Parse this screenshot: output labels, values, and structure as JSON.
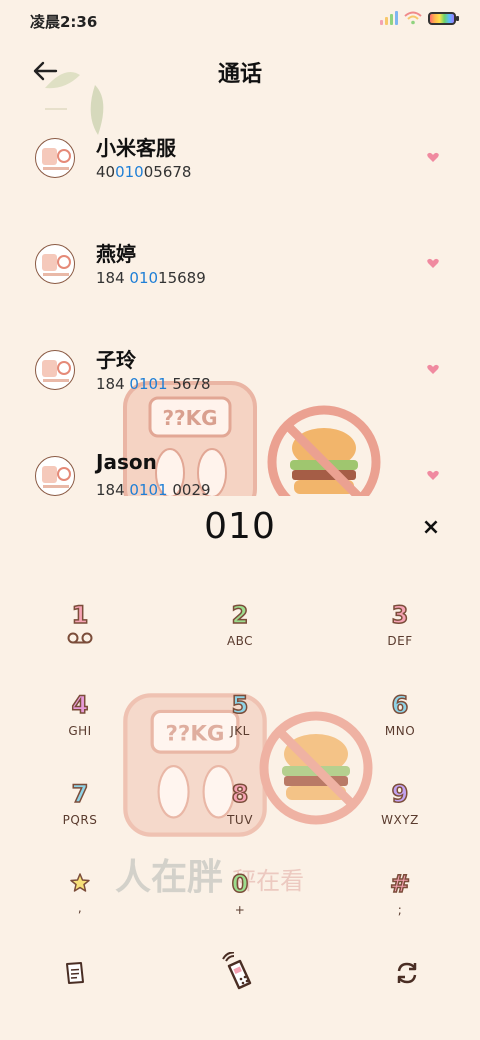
{
  "status_bar": {
    "time": "凌晨2:36"
  },
  "header": {
    "title": "通话",
    "back_icon": "arrow-left-icon"
  },
  "contacts": [
    {
      "name": "小米客服",
      "number_pre": "40",
      "number_hl": "010",
      "number_post": "05678"
    },
    {
      "name": "燕婷",
      "number_pre": "184 ",
      "number_hl": "010",
      "number_post": "15689"
    },
    {
      "name": "子玲",
      "number_pre": "184 ",
      "number_hl": "0101",
      "number_post": " 5678"
    },
    {
      "name": "Jason",
      "number_pre": "184 ",
      "number_hl": "0101",
      "number_post": " 0029"
    }
  ],
  "dialer": {
    "input": "010",
    "clear_label": "×",
    "keys": [
      {
        "digit": "1",
        "letters": "",
        "color": "#f6a3b4"
      },
      {
        "digit": "2",
        "letters": "ABC",
        "color": "#9ddc8d"
      },
      {
        "digit": "3",
        "letters": "DEF",
        "color": "#f6a3b4"
      },
      {
        "digit": "4",
        "letters": "GHI",
        "color": "#e79ad8"
      },
      {
        "digit": "5",
        "letters": "JKL",
        "color": "#8fd3e6"
      },
      {
        "digit": "6",
        "letters": "MNO",
        "color": "#8fd3e6"
      },
      {
        "digit": "7",
        "letters": "PQRS",
        "color": "#8fd3e6"
      },
      {
        "digit": "8",
        "letters": "TUV",
        "color": "#f6a3b4"
      },
      {
        "digit": "9",
        "letters": "WXYZ",
        "color": "#c3a3f0"
      },
      {
        "digit": "*",
        "letters": ",",
        "color": "#f7e07a"
      },
      {
        "digit": "0",
        "letters": "+",
        "color": "#9ddc8d"
      },
      {
        "digit": "#",
        "letters": ";",
        "color": "#f6a3b4"
      }
    ]
  },
  "background_text": {
    "big": "人在胖",
    "small": "秤在看"
  },
  "scale_label": "??KG",
  "colors": {
    "background": "#fbf1e6",
    "highlight": "#1f7fd6",
    "heart": "#f08aa0",
    "outline": "#7b4d3a"
  },
  "bottom_bar": {
    "left_icon": "notes-icon",
    "center_icon": "phone-call-icon",
    "right_icon": "swap-icon"
  }
}
